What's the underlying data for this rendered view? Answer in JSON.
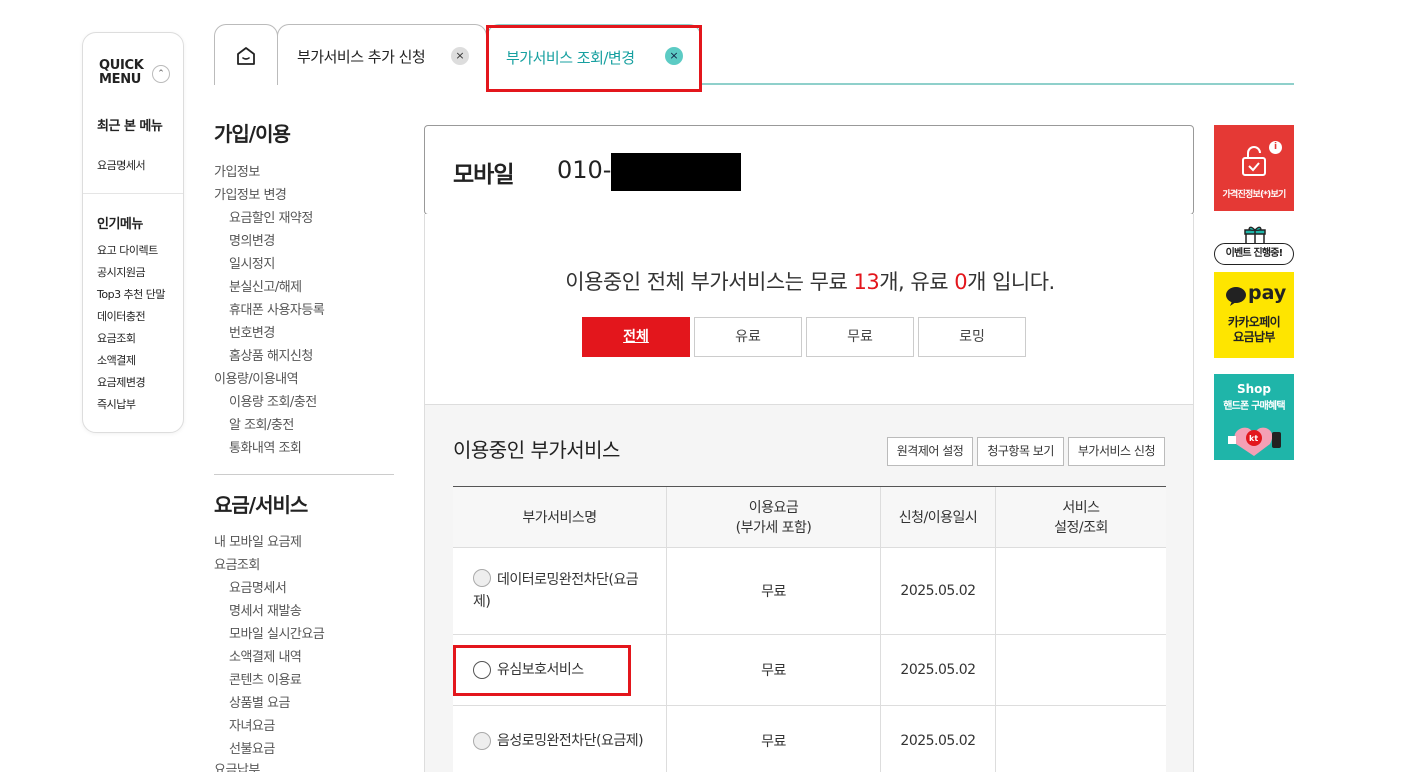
{
  "quick_menu": {
    "title_line1": "QUICK",
    "title_line2": "MENU",
    "toggle_glyph": "⌃",
    "recent_heading": "최근 본 메뉴",
    "recent_items": [
      "요금명세서"
    ],
    "popular_heading": "인기메뉴",
    "popular_items": [
      "요고 다이렉트",
      "공시지원금",
      "Top3 추천 단말",
      "데이터충전",
      "요금조회",
      "소액결제",
      "요금제변경",
      "즉시납부"
    ]
  },
  "tabs": {
    "home_icon": "house-icon",
    "items": [
      {
        "label": "부가서비스 추가 신청",
        "close": "×"
      },
      {
        "label": "부가서비스 조회/변경",
        "close": "×"
      }
    ]
  },
  "left_nav": {
    "section1_heading": "가입/이용",
    "section1_items": [
      {
        "label": "가입정보",
        "level": 0
      },
      {
        "label": "가입정보 변경",
        "level": 0
      },
      {
        "label": "요금할인 재약정",
        "level": 1
      },
      {
        "label": "명의변경",
        "level": 1
      },
      {
        "label": "일시정지",
        "level": 1
      },
      {
        "label": "분실신고/해제",
        "level": 1
      },
      {
        "label": "휴대폰 사용자등록",
        "level": 1
      },
      {
        "label": "번호변경",
        "level": 1
      },
      {
        "label": "홈상품 해지신청",
        "level": 1
      },
      {
        "label": "이용량/이용내역",
        "level": 0
      },
      {
        "label": "이용량 조회/충전",
        "level": 1
      },
      {
        "label": "알 조회/충전",
        "level": 1
      },
      {
        "label": "통화내역 조회",
        "level": 1
      }
    ],
    "section2_heading": "요금/서비스",
    "section2_items": [
      {
        "label": "내 모바일 요금제",
        "level": 0
      },
      {
        "label": "요금조회",
        "level": 0
      },
      {
        "label": "요금명세서",
        "level": 1
      },
      {
        "label": "명세서 재발송",
        "level": 1
      },
      {
        "label": "모바일 실시간요금",
        "level": 1
      },
      {
        "label": "소액결제 내역",
        "level": 1
      },
      {
        "label": "콘텐츠 이용료",
        "level": 1
      },
      {
        "label": "상품별 요금",
        "level": 1
      },
      {
        "label": "자녀요금",
        "level": 1
      },
      {
        "label": "선불요금",
        "level": 1
      },
      {
        "label": "요금납부",
        "level": 0
      }
    ]
  },
  "main": {
    "line_label": "모바일",
    "phone_prefix": "010-",
    "summary_pre": "이용중인 전체 부가서비스는 무료 ",
    "free_count": "13",
    "summary_mid": "개, 유료 ",
    "paid_count": "0",
    "summary_post": "개 입니다.",
    "filters": [
      "전체",
      "유료",
      "무료",
      "로밍"
    ],
    "list_title": "이용중인 부가서비스",
    "actions": [
      "원격제어 설정",
      "청구항목 보기",
      "부가서비스 신청"
    ],
    "table": {
      "headers": [
        "부가서비스명",
        "이용요금\n(부가세 포함)",
        "신청/이용일시",
        "서비스\n설정/조회"
      ],
      "rows": [
        {
          "name": "데이터로밍완전차단(요금제)",
          "fee": "무료",
          "date": "2025.05.02",
          "setting": ""
        },
        {
          "name": "유심보호서비스",
          "fee": "무료",
          "date": "2025.05.02",
          "setting": ""
        },
        {
          "name": "음성로밍완전차단(요금제)",
          "fee": "무료",
          "date": "2025.05.02",
          "setting": ""
        }
      ]
    }
  },
  "right_side": {
    "price_info_label": "가격진정보(*)보기",
    "price_info_icon": "lock-icon",
    "event_badge": "이벤트 진행중!",
    "kakaopay_logo": "pay",
    "kakaopay_label_line1": "카카오페이",
    "kakaopay_label_line2": "요금납부",
    "shop_label": "Shop",
    "shop_sub": "핸드폰 구매혜택"
  },
  "colors": {
    "accent_red": "#e3161c",
    "teal": "#17a0a0",
    "kakao_yellow": "#fee500",
    "shop_teal": "#1fb5a9"
  }
}
